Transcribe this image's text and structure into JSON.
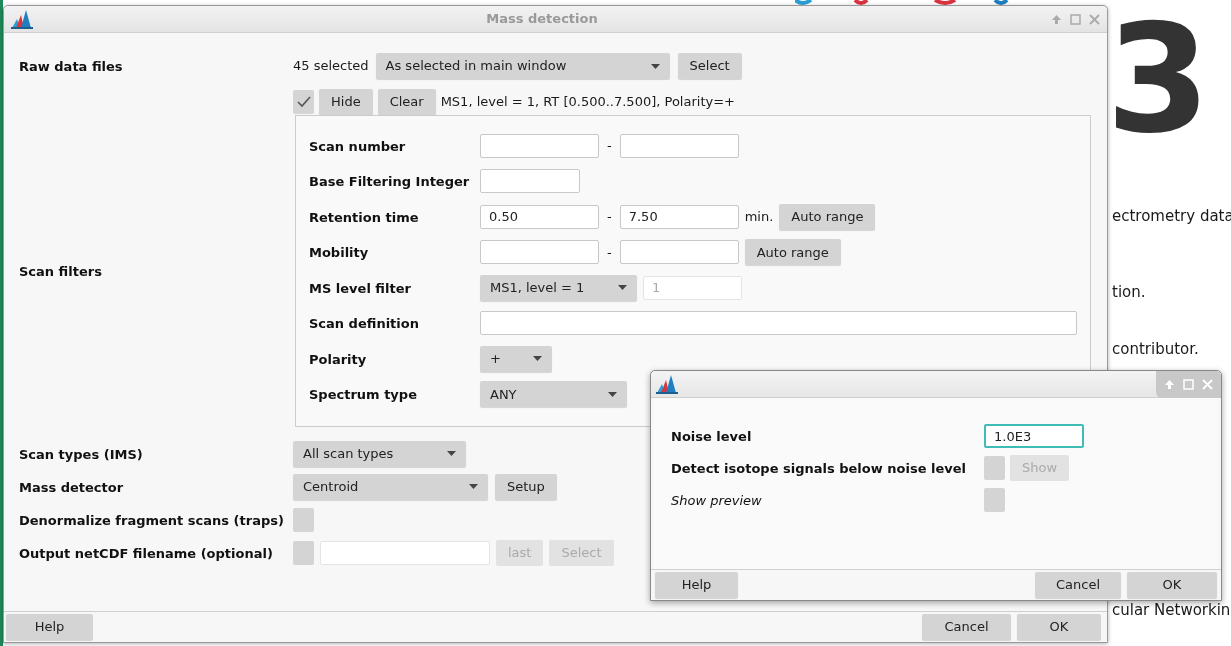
{
  "background_page": {
    "logo_text": "3",
    "fragments": [
      {
        "text": "ectrometry data",
        "bold": false
      },
      {
        "text": "tion.",
        "bold": false
      },
      {
        "text": "contributor.",
        "bold": false
      },
      {
        "text": "cular Networkin",
        "bold": false
      }
    ]
  },
  "main_dialog": {
    "title": "Mass detection",
    "raw_data_files": {
      "label": "Raw data files",
      "count": "45 selected",
      "dropdown": "As selected in main window",
      "select_button": "Select",
      "filter_checked": true,
      "hide_button": "Hide",
      "clear_button": "Clear",
      "summary": "MS1, level = 1, RT [0.500..7.500], Polarity=+"
    },
    "scan_filters": {
      "label": "Scan filters",
      "fields": [
        {
          "kind": "range",
          "label": "Scan number",
          "separator": "-"
        },
        {
          "kind": "single",
          "label": "Base Filtering Integer"
        },
        {
          "kind": "range",
          "label": "Retention time",
          "separator": "-",
          "from": "0.50",
          "to": "7.50",
          "unit": "min.",
          "button": "Auto range"
        },
        {
          "kind": "range",
          "label": "Mobility",
          "separator": "-",
          "button": "Auto range"
        },
        {
          "kind": "dropdown",
          "label": "MS level filter",
          "value": "MS1, level = 1",
          "extra_value": "1"
        },
        {
          "kind": "text",
          "label": "Scan definition"
        },
        {
          "kind": "dropdown",
          "label": "Polarity",
          "value": "+"
        },
        {
          "kind": "dropdown",
          "label": "Spectrum type",
          "value": "ANY"
        }
      ]
    },
    "rows": [
      {
        "kind": "dropdown",
        "label": "Scan types (IMS)",
        "value": "All scan types"
      },
      {
        "kind": "dropdown",
        "label": "Mass detector",
        "value": "Centroid",
        "button": "Setup"
      },
      {
        "kind": "checkbox",
        "label": "Denormalize fragment scans (traps)",
        "checked": false
      },
      {
        "kind": "file",
        "label": "Output netCDF filename (optional)",
        "checked": false,
        "buttons": [
          "last",
          "Select"
        ]
      }
    ],
    "footer": {
      "help": "Help",
      "cancel": "Cancel",
      "ok": "OK"
    }
  },
  "setup_dialog": {
    "rows": [
      {
        "kind": "field",
        "label": "Noise level",
        "value": "1.0E3",
        "focused": true
      },
      {
        "kind": "checkbox",
        "label": "Detect isotope signals below noise level",
        "checked": false,
        "button": "Show"
      },
      {
        "kind": "checkbox",
        "label": "Show preview",
        "checked": false,
        "italic": true
      }
    ],
    "footer": {
      "help": "Help",
      "cancel": "Cancel",
      "ok": "OK"
    }
  }
}
